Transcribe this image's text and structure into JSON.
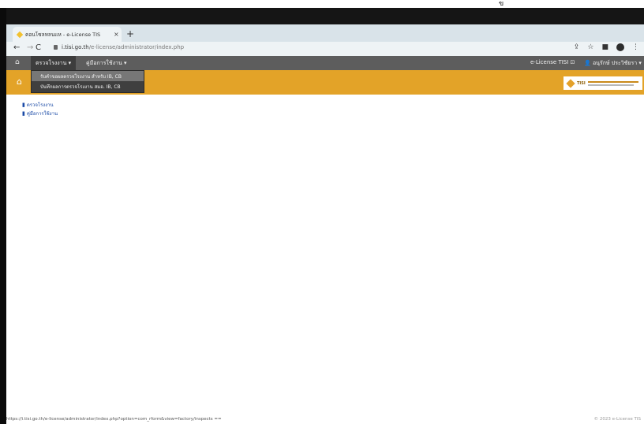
{
  "scan": {
    "top_mark": "ข"
  },
  "browser": {
    "tab": {
      "title": "คอนโซลหลนแห - e-License TIS",
      "close": "×"
    },
    "new_tab": "+",
    "address": {
      "host": "i.tisi.go.th",
      "path": "/e-license/administrator/index.php"
    },
    "icons": [
      "back-icon",
      "forward-icon",
      "reload-icon",
      "lock-icon",
      "share-icon",
      "star-icon",
      "sidebar-icon",
      "profile-icon",
      "more-icon"
    ]
  },
  "navbar": {
    "menu1": "ตรวจโรงงาน ▾",
    "menu2": "คู่มือการใช้งาน ▾",
    "right_link": "e-License TISI ⊡",
    "user": "👤 อนุรักษ์ ประวิชัยรา ▾"
  },
  "dropdown": [
    "รับคำขอผลตรวจโรงงาน สำหรับ IB, CB",
    "บันทึกผลการตรวจโรงงาน สมอ. IB, CB"
  ],
  "header": {
    "logo_label": "TISI"
  },
  "sidebar": [
    {
      "icon": "▮",
      "label": "ตรวจโรงงาน"
    },
    {
      "icon": "▮",
      "label": "คู่มือการใช้งาน"
    }
  ],
  "status_bar": {
    "url": "https://i.tisi.go.th/e-license/administrator/index.php?option=com_rform&view=factory/inspects ==",
    "copyright": "© 2023 e-License TIS"
  },
  "colors": {
    "accent": "#e3a328",
    "nav_dark": "#5d5d5d",
    "link_blue": "#1a4aa6"
  }
}
